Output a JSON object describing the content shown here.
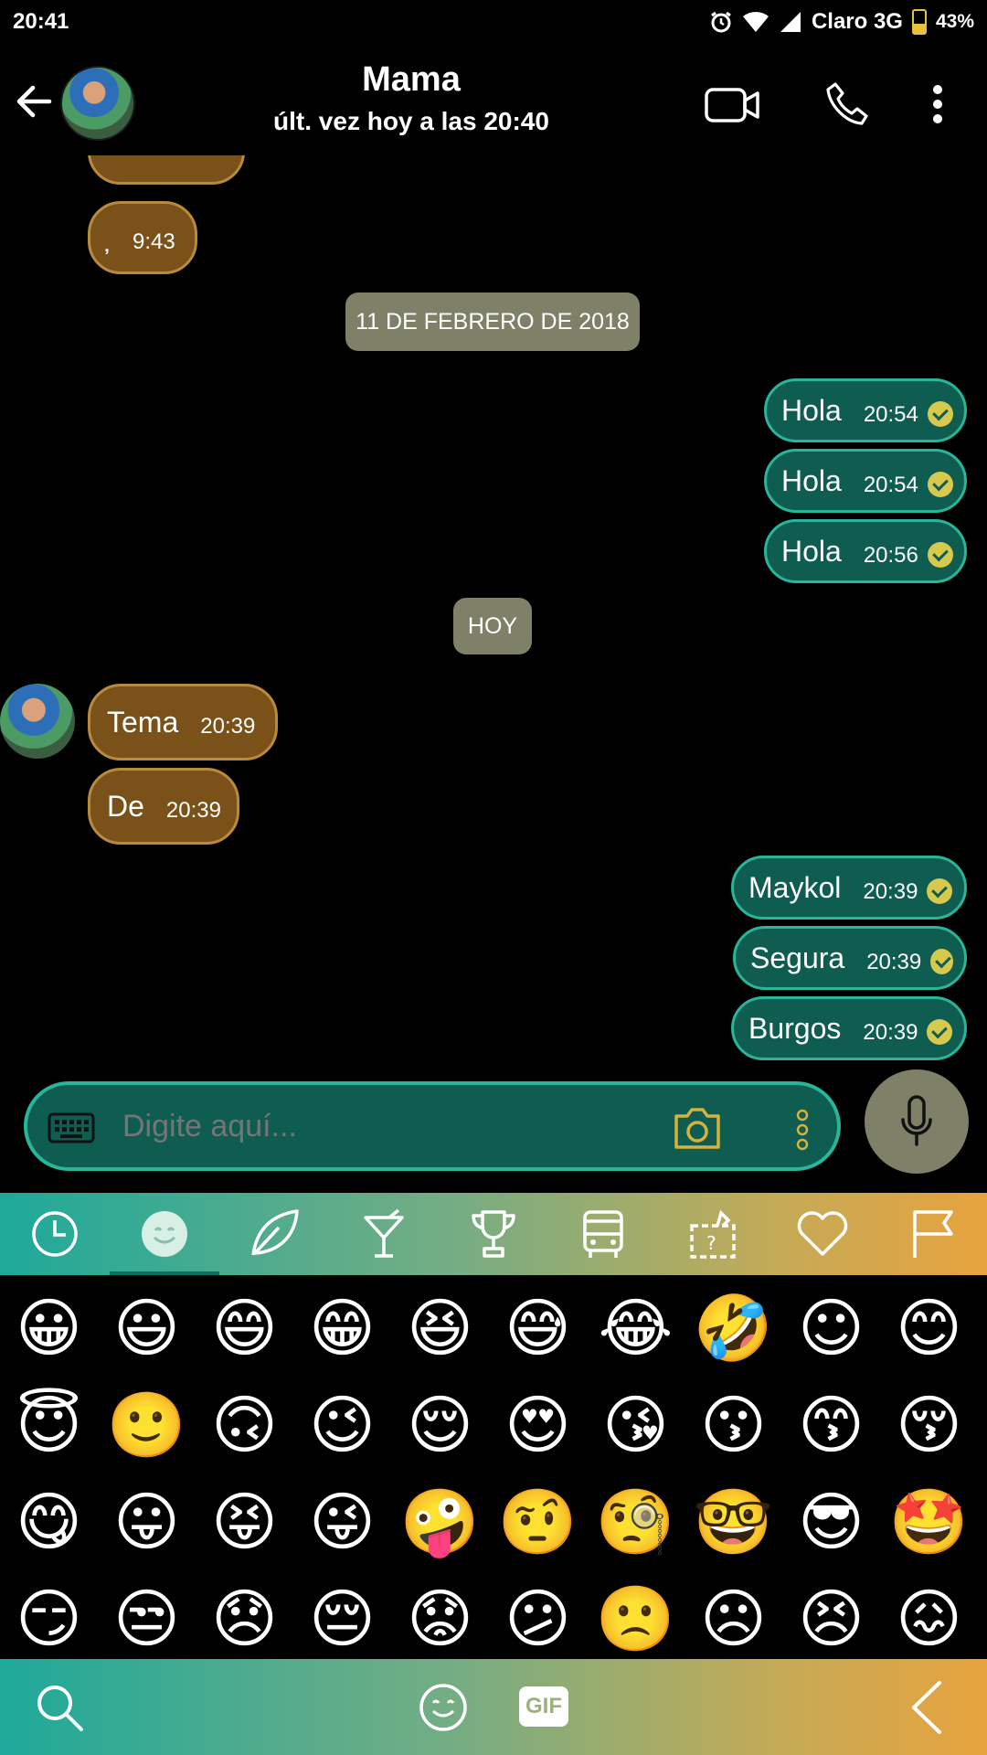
{
  "status_bar": {
    "time": "20:41",
    "carrier": "Claro 3G",
    "battery": "43%",
    "battery_level": 0.43
  },
  "header": {
    "contact_name": "Mama",
    "last_seen": "últ. vez hoy a las 20:40"
  },
  "messages": [
    {
      "dir": "in",
      "text": "̦",
      "time": "9:43"
    },
    {
      "dir": "date",
      "text": "11 DE FEBRERO DE 2018"
    },
    {
      "dir": "out",
      "text": "Hola",
      "time": "20:54"
    },
    {
      "dir": "out",
      "text": "Hola",
      "time": "20:54"
    },
    {
      "dir": "out",
      "text": "Hola",
      "time": "20:56"
    },
    {
      "dir": "date",
      "text": "HOY"
    },
    {
      "dir": "in",
      "text": "Tema",
      "time": "20:39"
    },
    {
      "dir": "in",
      "text": "De",
      "time": "20:39"
    },
    {
      "dir": "out",
      "text": "Maykol",
      "time": "20:39"
    },
    {
      "dir": "out",
      "text": "Segura",
      "time": "20:39"
    },
    {
      "dir": "out",
      "text": "Burgos",
      "time": "20:39"
    }
  ],
  "input": {
    "placeholder": "Digite aquí..."
  },
  "emoji_tabs": [
    "recent-icon",
    "smileys-icon",
    "nature-icon",
    "drinks-icon",
    "trophy-icon",
    "bus-icon",
    "objects-icon",
    "heart-icon",
    "flag-icon"
  ],
  "emoji_rows": [
    [
      "😀",
      "😃",
      "😄",
      "😁",
      "😆",
      "😅",
      "😂",
      "🤣",
      "☺",
      "😊"
    ],
    [
      "😇",
      "🙂",
      "🙃",
      "😉",
      "😌",
      "😍",
      "😘",
      "😗",
      "😙",
      "😚"
    ],
    [
      "😋",
      "😛",
      "😝",
      "😜",
      "🤪",
      "🤨",
      "🧐",
      "🤓",
      "😎",
      "🤩"
    ],
    [
      "😏",
      "😒",
      "😞",
      "😔",
      "😟",
      "😕",
      "🙁",
      "☹",
      "😣",
      "😖"
    ]
  ],
  "bottom_bar": {
    "gif_label": "GIF"
  },
  "colors": {
    "incoming_bubble": "#7a5219",
    "outgoing_bubble": "#0f5d51",
    "date_pill": "#7e8167",
    "read_check": "#d7c94d"
  }
}
